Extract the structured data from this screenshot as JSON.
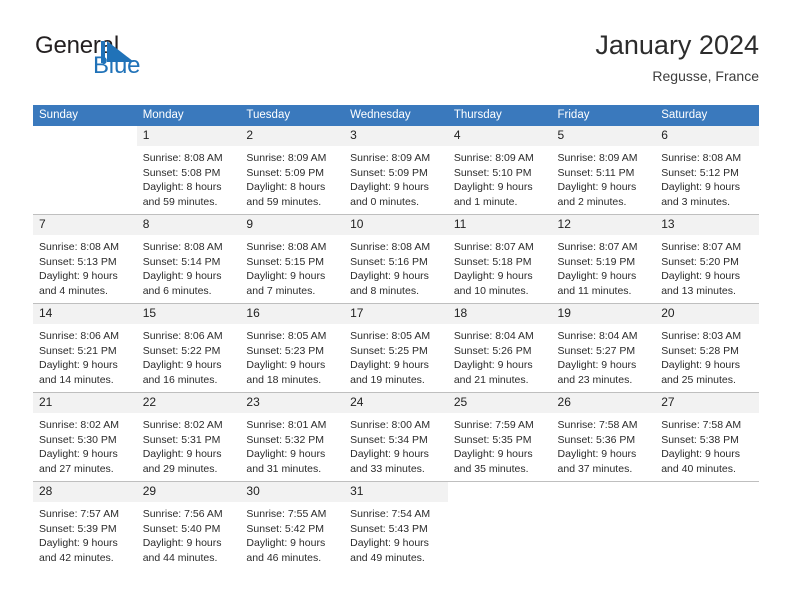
{
  "brand": {
    "name_part1": "General",
    "name_part2": "Blue",
    "mark": "triangle-logo",
    "accent_color": "#2072b8"
  },
  "header": {
    "title": "January 2024",
    "subtitle": "Regusse, France"
  },
  "theme": {
    "header_row_bg": "#3a79bd",
    "daynum_bg": "#f2f2f2",
    "grid_line": "#bfbfbf",
    "text": "#222222"
  },
  "weekdays": [
    "Sunday",
    "Monday",
    "Tuesday",
    "Wednesday",
    "Thursday",
    "Friday",
    "Saturday"
  ],
  "weeks": [
    [
      {
        "day": "",
        "lines": []
      },
      {
        "day": "1",
        "lines": [
          "Sunrise: 8:08 AM",
          "Sunset: 5:08 PM",
          "Daylight: 8 hours",
          "and 59 minutes."
        ]
      },
      {
        "day": "2",
        "lines": [
          "Sunrise: 8:09 AM",
          "Sunset: 5:09 PM",
          "Daylight: 8 hours",
          "and 59 minutes."
        ]
      },
      {
        "day": "3",
        "lines": [
          "Sunrise: 8:09 AM",
          "Sunset: 5:09 PM",
          "Daylight: 9 hours",
          "and 0 minutes."
        ]
      },
      {
        "day": "4",
        "lines": [
          "Sunrise: 8:09 AM",
          "Sunset: 5:10 PM",
          "Daylight: 9 hours",
          "and 1 minute."
        ]
      },
      {
        "day": "5",
        "lines": [
          "Sunrise: 8:09 AM",
          "Sunset: 5:11 PM",
          "Daylight: 9 hours",
          "and 2 minutes."
        ]
      },
      {
        "day": "6",
        "lines": [
          "Sunrise: 8:08 AM",
          "Sunset: 5:12 PM",
          "Daylight: 9 hours",
          "and 3 minutes."
        ]
      }
    ],
    [
      {
        "day": "7",
        "lines": [
          "Sunrise: 8:08 AM",
          "Sunset: 5:13 PM",
          "Daylight: 9 hours",
          "and 4 minutes."
        ]
      },
      {
        "day": "8",
        "lines": [
          "Sunrise: 8:08 AM",
          "Sunset: 5:14 PM",
          "Daylight: 9 hours",
          "and 6 minutes."
        ]
      },
      {
        "day": "9",
        "lines": [
          "Sunrise: 8:08 AM",
          "Sunset: 5:15 PM",
          "Daylight: 9 hours",
          "and 7 minutes."
        ]
      },
      {
        "day": "10",
        "lines": [
          "Sunrise: 8:08 AM",
          "Sunset: 5:16 PM",
          "Daylight: 9 hours",
          "and 8 minutes."
        ]
      },
      {
        "day": "11",
        "lines": [
          "Sunrise: 8:07 AM",
          "Sunset: 5:18 PM",
          "Daylight: 9 hours",
          "and 10 minutes."
        ]
      },
      {
        "day": "12",
        "lines": [
          "Sunrise: 8:07 AM",
          "Sunset: 5:19 PM",
          "Daylight: 9 hours",
          "and 11 minutes."
        ]
      },
      {
        "day": "13",
        "lines": [
          "Sunrise: 8:07 AM",
          "Sunset: 5:20 PM",
          "Daylight: 9 hours",
          "and 13 minutes."
        ]
      }
    ],
    [
      {
        "day": "14",
        "lines": [
          "Sunrise: 8:06 AM",
          "Sunset: 5:21 PM",
          "Daylight: 9 hours",
          "and 14 minutes."
        ]
      },
      {
        "day": "15",
        "lines": [
          "Sunrise: 8:06 AM",
          "Sunset: 5:22 PM",
          "Daylight: 9 hours",
          "and 16 minutes."
        ]
      },
      {
        "day": "16",
        "lines": [
          "Sunrise: 8:05 AM",
          "Sunset: 5:23 PM",
          "Daylight: 9 hours",
          "and 18 minutes."
        ]
      },
      {
        "day": "17",
        "lines": [
          "Sunrise: 8:05 AM",
          "Sunset: 5:25 PM",
          "Daylight: 9 hours",
          "and 19 minutes."
        ]
      },
      {
        "day": "18",
        "lines": [
          "Sunrise: 8:04 AM",
          "Sunset: 5:26 PM",
          "Daylight: 9 hours",
          "and 21 minutes."
        ]
      },
      {
        "day": "19",
        "lines": [
          "Sunrise: 8:04 AM",
          "Sunset: 5:27 PM",
          "Daylight: 9 hours",
          "and 23 minutes."
        ]
      },
      {
        "day": "20",
        "lines": [
          "Sunrise: 8:03 AM",
          "Sunset: 5:28 PM",
          "Daylight: 9 hours",
          "and 25 minutes."
        ]
      }
    ],
    [
      {
        "day": "21",
        "lines": [
          "Sunrise: 8:02 AM",
          "Sunset: 5:30 PM",
          "Daylight: 9 hours",
          "and 27 minutes."
        ]
      },
      {
        "day": "22",
        "lines": [
          "Sunrise: 8:02 AM",
          "Sunset: 5:31 PM",
          "Daylight: 9 hours",
          "and 29 minutes."
        ]
      },
      {
        "day": "23",
        "lines": [
          "Sunrise: 8:01 AM",
          "Sunset: 5:32 PM",
          "Daylight: 9 hours",
          "and 31 minutes."
        ]
      },
      {
        "day": "24",
        "lines": [
          "Sunrise: 8:00 AM",
          "Sunset: 5:34 PM",
          "Daylight: 9 hours",
          "and 33 minutes."
        ]
      },
      {
        "day": "25",
        "lines": [
          "Sunrise: 7:59 AM",
          "Sunset: 5:35 PM",
          "Daylight: 9 hours",
          "and 35 minutes."
        ]
      },
      {
        "day": "26",
        "lines": [
          "Sunrise: 7:58 AM",
          "Sunset: 5:36 PM",
          "Daylight: 9 hours",
          "and 37 minutes."
        ]
      },
      {
        "day": "27",
        "lines": [
          "Sunrise: 7:58 AM",
          "Sunset: 5:38 PM",
          "Daylight: 9 hours",
          "and 40 minutes."
        ]
      }
    ],
    [
      {
        "day": "28",
        "lines": [
          "Sunrise: 7:57 AM",
          "Sunset: 5:39 PM",
          "Daylight: 9 hours",
          "and 42 minutes."
        ]
      },
      {
        "day": "29",
        "lines": [
          "Sunrise: 7:56 AM",
          "Sunset: 5:40 PM",
          "Daylight: 9 hours",
          "and 44 minutes."
        ]
      },
      {
        "day": "30",
        "lines": [
          "Sunrise: 7:55 AM",
          "Sunset: 5:42 PM",
          "Daylight: 9 hours",
          "and 46 minutes."
        ]
      },
      {
        "day": "31",
        "lines": [
          "Sunrise: 7:54 AM",
          "Sunset: 5:43 PM",
          "Daylight: 9 hours",
          "and 49 minutes."
        ]
      },
      {
        "day": "",
        "lines": []
      },
      {
        "day": "",
        "lines": []
      },
      {
        "day": "",
        "lines": []
      }
    ]
  ]
}
